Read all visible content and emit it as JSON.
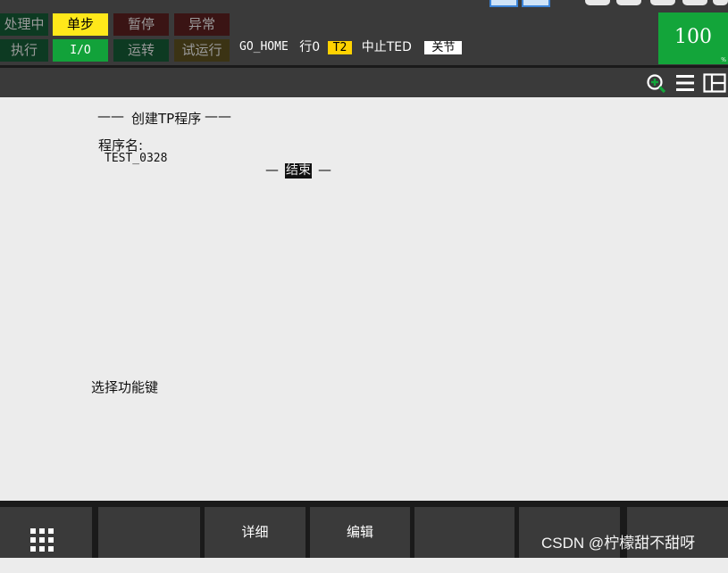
{
  "status_indicators": {
    "row1": [
      {
        "label": "处理中",
        "bg": "#0d3a22",
        "fg": "#9a9a9a"
      },
      {
        "label": "单步",
        "bg": "#ffe81a",
        "fg": "#000000"
      },
      {
        "label": "暂停",
        "bg": "#3a1414",
        "fg": "#9a9a9a"
      },
      {
        "label": "异常",
        "bg": "#3a1414",
        "fg": "#9a9a9a"
      }
    ],
    "row2": [
      {
        "label": "执行",
        "bg": "#0d3a22",
        "fg": "#9a9a9a"
      },
      {
        "label": "I/O",
        "bg": "#12a23a",
        "fg": "#ffffff"
      },
      {
        "label": "运转",
        "bg": "#0d3a22",
        "fg": "#9a9a9a"
      },
      {
        "label": "试运行",
        "bg": "#3b3314",
        "fg": "#9a9a9a"
      }
    ]
  },
  "status_line": {
    "program": "GO_HOME",
    "line": "行0",
    "tool": "T2",
    "state": "中止TED",
    "coord": "关节"
  },
  "override": {
    "value": "100",
    "unit": "%"
  },
  "toolbar": {
    "icons": [
      "zoom-in-icon",
      "list-icon",
      "split-view-icon"
    ]
  },
  "content": {
    "heading_dash_left": "——",
    "heading": "创建TP程序",
    "heading_dash_right": "——",
    "program_name_label": "程序名:",
    "program_name_value": "TEST_0328",
    "end_dash_left": "—",
    "end_label": "结束",
    "end_dash_right": "—",
    "prompt": "选择功能键"
  },
  "function_keys": [
    {
      "label": "",
      "icon": "grid-icon"
    },
    {
      "label": ""
    },
    {
      "label": "详细"
    },
    {
      "label": "编辑"
    },
    {
      "label": ""
    },
    {
      "label": ""
    },
    {
      "label": ""
    }
  ],
  "watermark": "CSDN @柠檬甜不甜呀",
  "colors": {
    "panel_dark": "#3a3a3a",
    "content_bg": "#ececec",
    "accent_yellow": "#ffd200",
    "accent_green": "#13a53a"
  }
}
